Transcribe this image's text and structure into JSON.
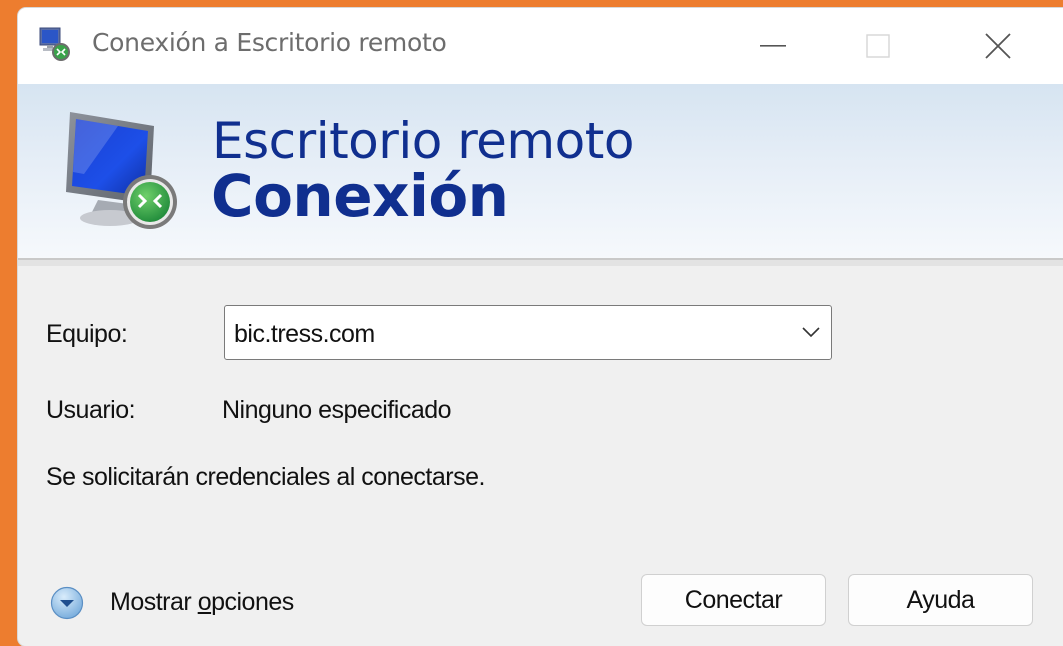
{
  "window": {
    "title": "Conexión a Escritorio remoto",
    "controls": [
      "minimize",
      "maximize",
      "close"
    ]
  },
  "banner": {
    "line1": "Escritorio remoto",
    "line2": "Conexión"
  },
  "form": {
    "computer_label": "Equipo:",
    "computer_value": "bic.tress.com",
    "user_label": "Usuario:",
    "user_value": "Ninguno especificado",
    "credentials_note": "Se solicitarán credenciales al conectarse."
  },
  "footer": {
    "show_options_prefix": "Mostrar ",
    "show_options_underlined": "o",
    "show_options_suffix": "pciones",
    "connect_label": "Conectar",
    "help_label": "Ayuda"
  },
  "colors": {
    "background": "#ed7d2f",
    "banner_text": "#102f8f",
    "window": "#f0f0f0"
  },
  "icons": {
    "app": "remote-desktop-icon",
    "hero": "remote-desktop-monitor-icon",
    "dropdown": "chevron-down-icon",
    "options": "expand-circle-icon"
  }
}
